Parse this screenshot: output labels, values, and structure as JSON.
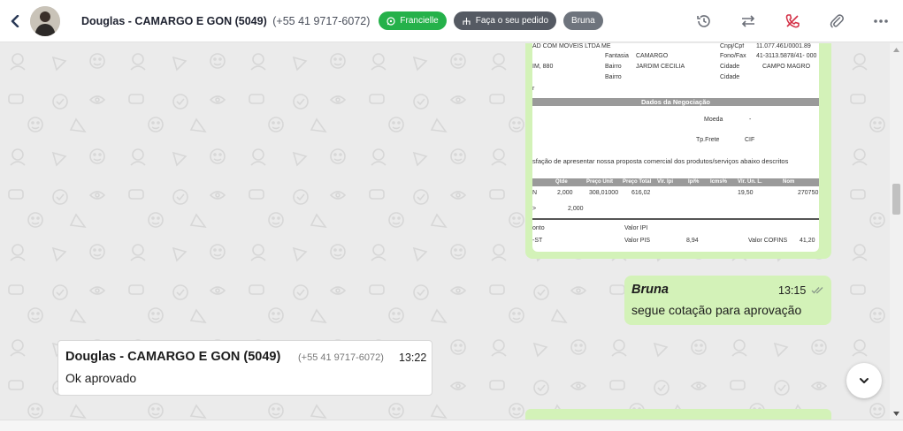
{
  "header": {
    "contact_name": "Douglas - CAMARGO E GON (5049)",
    "contact_phone": "(+55 41 9717-6072)",
    "tags": [
      {
        "label": "Francielle",
        "icon": "whatsapp-icon",
        "color": "#25b14a"
      },
      {
        "label": "Faça o seu pedido",
        "icon": "flow-icon",
        "color": "#555a63"
      },
      {
        "label": "Bruna",
        "color": "#6e747d"
      }
    ],
    "actions": [
      "history-icon",
      "transfer-icon",
      "end-call-icon",
      "attachment-icon",
      "more-icon"
    ]
  },
  "document": {
    "company_line": "AD COM MOVEIS LTDA ME",
    "cnpj_label": "Cnpj/Cpf",
    "cnpj_value": "11.077.461/0001.89",
    "fantasia_label": "Fantasia",
    "fantasia_value": "CAMARGO",
    "fone_label": "Fono/Fax",
    "fone_value": "41-3113.5878/41- 000",
    "address_frag": "IM, 880",
    "bairro_label": "Bairro",
    "bairro_value": "JARDIM CECILIA",
    "cidade_label": "Cidade",
    "cidade_value": "CAMPO MAGRO",
    "bairro2_label": "Bairro",
    "cidade2_label": "Cidade",
    "r_frag": "r",
    "section_title": "Dados da Negociação",
    "moeda_label": "Moeda",
    "moeda_value": "-",
    "frete_label": "Tp.Frete",
    "frete_value": "CIF",
    "intro_text": "sfação de apresentar nossa proposta comercial dos produtos/serviços abaixo descritos",
    "table_headers": [
      "Qtde",
      "Preço Unit",
      "Preço Total",
      "Vlr. Ipi",
      "Ipi%",
      "Icms%",
      "Vlr. Un. L.",
      "Nom"
    ],
    "row1": [
      "N",
      "2,000",
      "308,01000",
      "616,02",
      "19,50",
      "270750"
    ],
    "row2": [
      ">",
      "2,000"
    ],
    "totals": {
      "onto": "onto",
      "st": "-ST",
      "ipi_label": "Valor IPI",
      "pis_label": "Valor PIS",
      "pis_value": "8,94",
      "cofins_label": "Valor COFINS",
      "cofins_value": "41,20"
    }
  },
  "messages": {
    "outgoing": {
      "sender": "Bruna",
      "time": "13:15",
      "text": "segue cotação para aprovação"
    },
    "incoming": {
      "sender": "Douglas - CAMARGO E GON (5049)",
      "phone": "(+55 41 9717-6072)",
      "time": "13:22",
      "text": "Ok aprovado"
    }
  },
  "colors": {
    "bubble_out": "#d3f2b8",
    "accent_green": "#25b14a",
    "background": "#ebebeb"
  }
}
